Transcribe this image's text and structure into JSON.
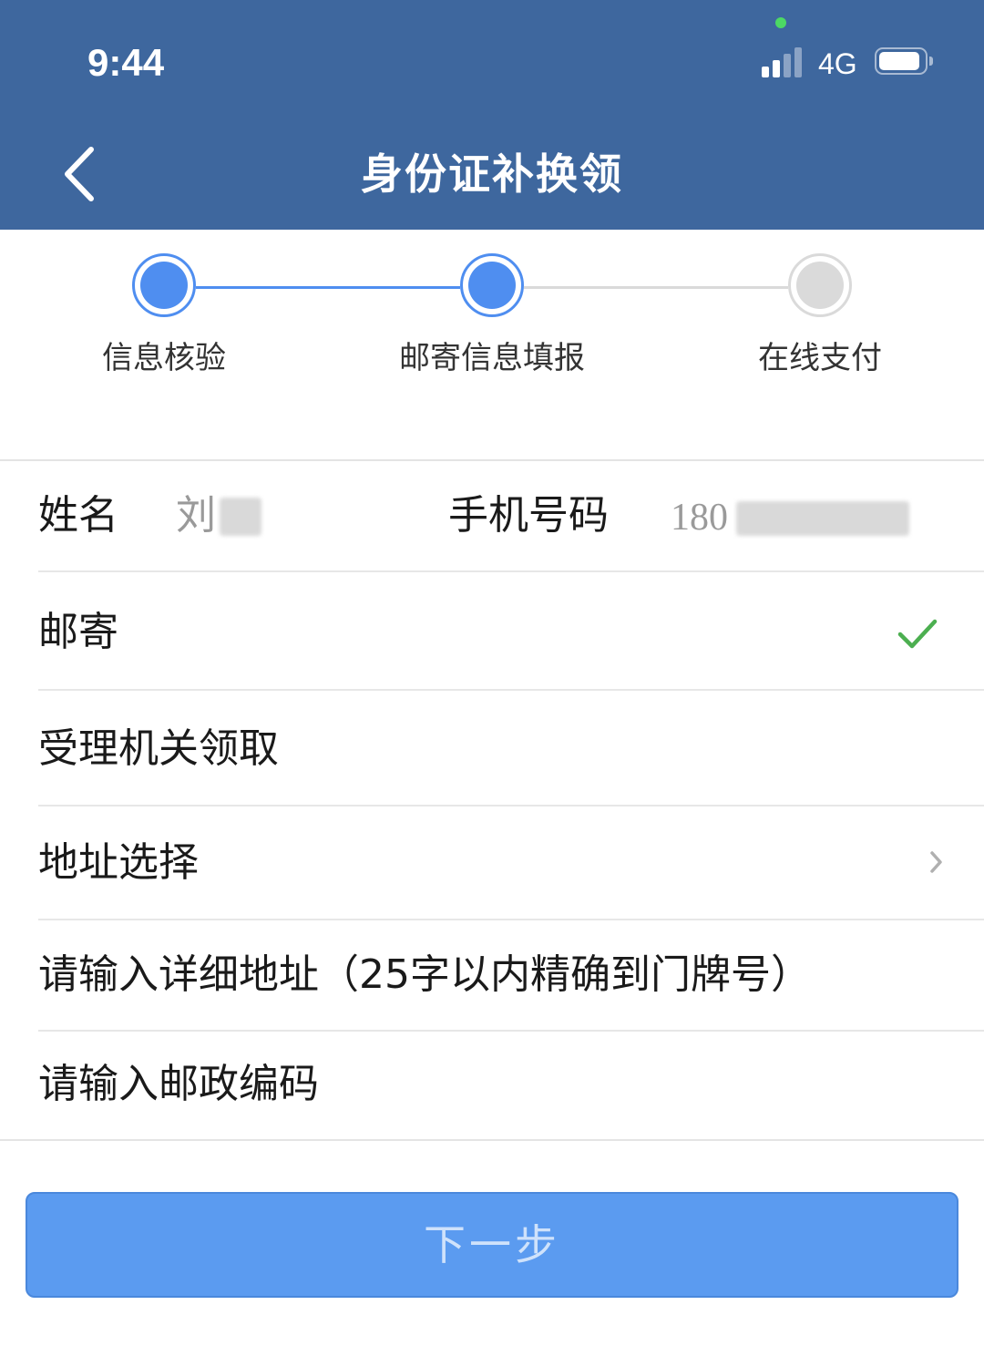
{
  "status_bar": {
    "time": "9:44",
    "network": "4G",
    "signal_bars_filled": 2,
    "signal_bars_total": 4,
    "battery_level": 0.8
  },
  "nav": {
    "title": "身份证补换领",
    "back_icon": "chevron-left-icon"
  },
  "steps": [
    {
      "label": "信息核验",
      "state": "done"
    },
    {
      "label": "邮寄信息填报",
      "state": "current"
    },
    {
      "label": "在线支付",
      "state": "pending"
    }
  ],
  "form": {
    "name_label": "姓名",
    "name_value": "刘",
    "phone_label": "手机号码",
    "phone_value": "180",
    "mail_option": "邮寄",
    "mail_selected": true,
    "pickup_option": "受理机关领取",
    "address_select": "地址选择",
    "detail_address_placeholder": "请输入详细地址（25字以内精确到门牌号）",
    "postal_code_placeholder": "请输入邮政编码"
  },
  "next_button": "下一步",
  "colors": {
    "header_bg": "#3e679e",
    "step_active": "#4f8ef0",
    "step_inactive": "#dadada",
    "check": "#4caf50",
    "button_bg": "#5b9bf0"
  }
}
